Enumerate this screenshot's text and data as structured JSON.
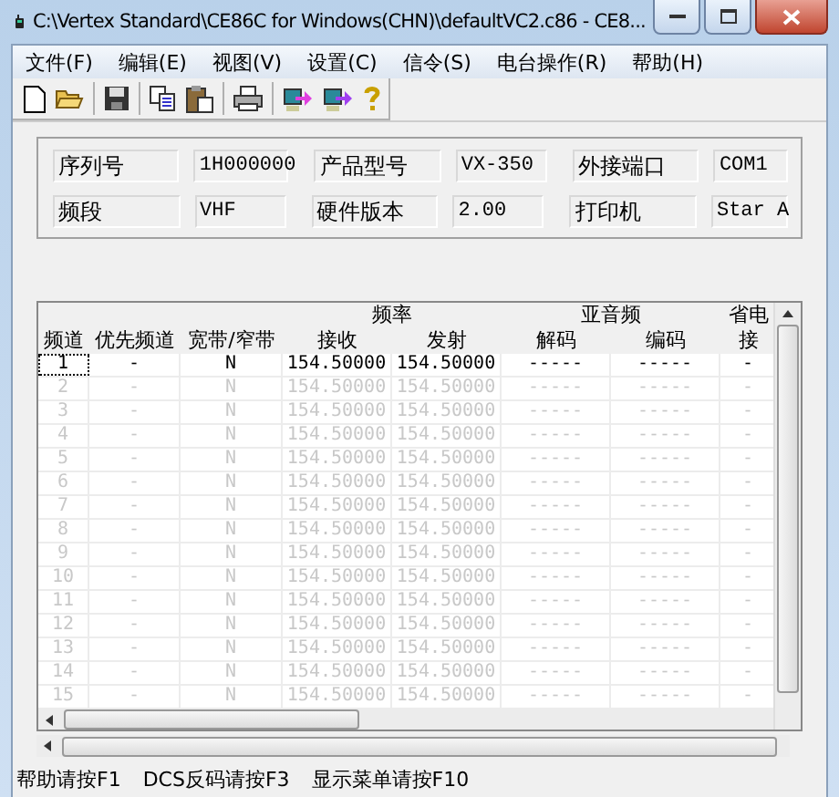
{
  "window": {
    "title": "C:\\Vertex Standard\\CE86C for Windows(CHN)\\defaultVC2.c86 - CE8..."
  },
  "menu": [
    "文件(F)",
    "编辑(E)",
    "视图(V)",
    "设置(C)",
    "信令(S)",
    "电台操作(R)",
    "帮助(H)"
  ],
  "info": [
    [
      {
        "label": "序列号",
        "value": "1H000000"
      },
      {
        "label": "产品型号",
        "value": "VX-350"
      },
      {
        "label": "外接端口",
        "value": "COM1"
      }
    ],
    [
      {
        "label": "频段",
        "value": "VHF"
      },
      {
        "label": "硬件版本",
        "value": "2.00"
      },
      {
        "label": "打印机",
        "value": "Star A"
      }
    ]
  ],
  "table": {
    "groups": [
      "频率",
      "亚音频",
      "省电"
    ],
    "columns": [
      "频道",
      "优先频道",
      "宽带/窄带",
      "接收",
      "发射",
      "解码",
      "编码",
      "接"
    ],
    "rows": [
      {
        "selected": true,
        "disabled": false,
        "cells": [
          "1",
          "-",
          "N",
          "154.50000",
          "154.50000",
          "-----",
          "-----",
          "-"
        ]
      },
      {
        "selected": false,
        "disabled": true,
        "cells": [
          "2",
          "-",
          "N",
          "154.50000",
          "154.50000",
          "-----",
          "-----",
          "-"
        ]
      },
      {
        "selected": false,
        "disabled": true,
        "cells": [
          "3",
          "-",
          "N",
          "154.50000",
          "154.50000",
          "-----",
          "-----",
          "-"
        ]
      },
      {
        "selected": false,
        "disabled": true,
        "cells": [
          "4",
          "-",
          "N",
          "154.50000",
          "154.50000",
          "-----",
          "-----",
          "-"
        ]
      },
      {
        "selected": false,
        "disabled": true,
        "cells": [
          "5",
          "-",
          "N",
          "154.50000",
          "154.50000",
          "-----",
          "-----",
          "-"
        ]
      },
      {
        "selected": false,
        "disabled": true,
        "cells": [
          "6",
          "-",
          "N",
          "154.50000",
          "154.50000",
          "-----",
          "-----",
          "-"
        ]
      },
      {
        "selected": false,
        "disabled": true,
        "cells": [
          "7",
          "-",
          "N",
          "154.50000",
          "154.50000",
          "-----",
          "-----",
          "-"
        ]
      },
      {
        "selected": false,
        "disabled": true,
        "cells": [
          "8",
          "-",
          "N",
          "154.50000",
          "154.50000",
          "-----",
          "-----",
          "-"
        ]
      },
      {
        "selected": false,
        "disabled": true,
        "cells": [
          "9",
          "-",
          "N",
          "154.50000",
          "154.50000",
          "-----",
          "-----",
          "-"
        ]
      },
      {
        "selected": false,
        "disabled": true,
        "cells": [
          "10",
          "-",
          "N",
          "154.50000",
          "154.50000",
          "-----",
          "-----",
          "-"
        ]
      },
      {
        "selected": false,
        "disabled": true,
        "cells": [
          "11",
          "-",
          "N",
          "154.50000",
          "154.50000",
          "-----",
          "-----",
          "-"
        ]
      },
      {
        "selected": false,
        "disabled": true,
        "cells": [
          "12",
          "-",
          "N",
          "154.50000",
          "154.50000",
          "-----",
          "-----",
          "-"
        ]
      },
      {
        "selected": false,
        "disabled": true,
        "cells": [
          "13",
          "-",
          "N",
          "154.50000",
          "154.50000",
          "-----",
          "-----",
          "-"
        ]
      },
      {
        "selected": false,
        "disabled": true,
        "cells": [
          "14",
          "-",
          "N",
          "154.50000",
          "154.50000",
          "-----",
          "-----",
          "-"
        ]
      },
      {
        "selected": false,
        "disabled": true,
        "cells": [
          "15",
          "-",
          "N",
          "154.50000",
          "154.50000",
          "-----",
          "-----",
          "-"
        ]
      }
    ]
  },
  "status_bar": [
    "帮助请按F1",
    "DCS反码请按F3",
    "显示菜单请按F10"
  ]
}
